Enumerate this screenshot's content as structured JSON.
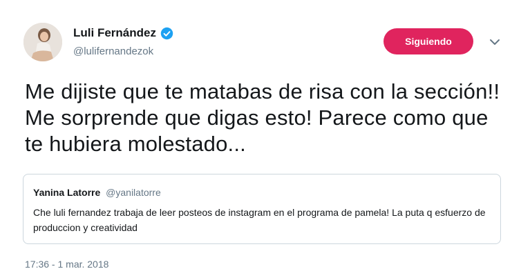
{
  "author": {
    "name": "Luli Fernández",
    "handle": "@lulifernandezok",
    "verified_icon": "verified-badge-icon"
  },
  "follow_button": {
    "label": "Siguiendo",
    "color": "#e0245e"
  },
  "menu": {
    "icon": "chevron-down-icon"
  },
  "tweet": {
    "text": "Me dijiste que te matabas de risa con la sección!! Me sorprende que digas esto! Parece como que te hubiera molestado..."
  },
  "quoted_tweet": {
    "name": "Yanina Latorre",
    "handle": "@yanilatorre",
    "text": "Che luli fernandez trabaja de leer posteos de instagram en el programa de pamela! La puta q esfuerzo de produccion y creatividad"
  },
  "meta": {
    "timestamp": "17:36 - 1 mar. 2018"
  },
  "colors": {
    "accent": "#e0245e",
    "verified": "#1da1f2",
    "muted": "#657786"
  }
}
